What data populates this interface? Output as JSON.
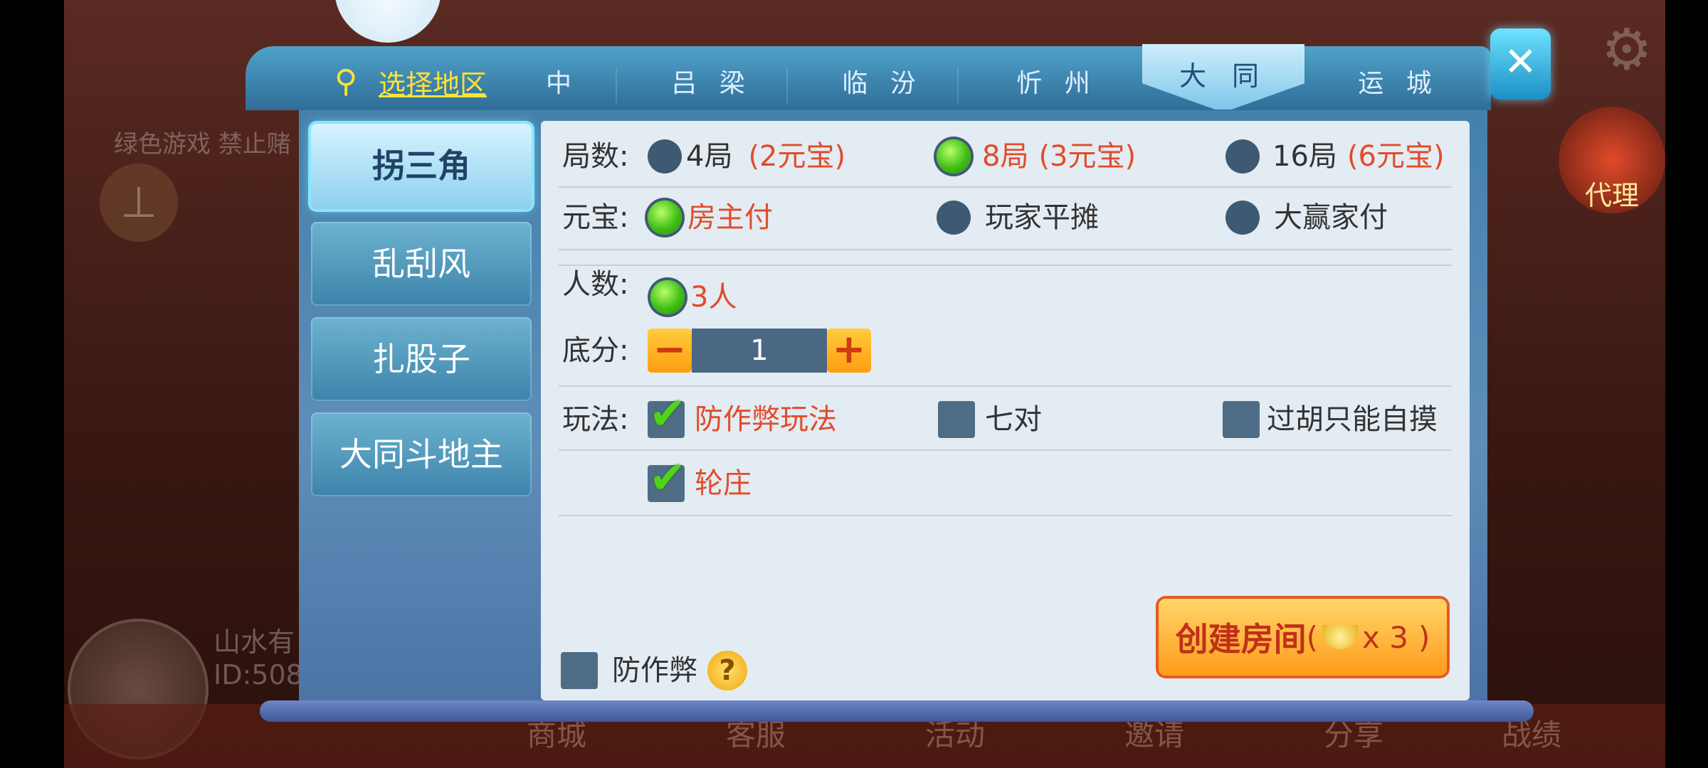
{
  "region": {
    "select_label": "选择地区",
    "tabs": [
      "中",
      "吕 梁",
      "临 汾",
      "忻 州",
      "大 同",
      "运 城"
    ],
    "active_tab": "大 同"
  },
  "games": [
    "拐三角",
    "乱刮风",
    "扎股子",
    "大同斗地主"
  ],
  "active_game": "拐三角",
  "settings": {
    "rounds": {
      "label": "局数:",
      "options": [
        {
          "name": "4局",
          "cost": "(2元宝)",
          "selected": false
        },
        {
          "name": "8局",
          "cost": "(3元宝)",
          "selected": true
        },
        {
          "name": "16局",
          "cost": "(6元宝)",
          "selected": false
        }
      ]
    },
    "payment": {
      "label": "元宝:",
      "options": [
        {
          "name": "房主付",
          "selected": true
        },
        {
          "name": "玩家平摊",
          "selected": false
        },
        {
          "name": "大赢家付",
          "selected": false
        }
      ]
    },
    "players": {
      "label": "人数:",
      "options": [
        {
          "name": "3人",
          "selected": true
        }
      ]
    },
    "base_score": {
      "label": "底分:",
      "value": "1",
      "minus": "−",
      "plus": "+"
    },
    "play_rules": {
      "label": "玩法:",
      "options": [
        {
          "name": "防作弊玩法",
          "checked": true
        },
        {
          "name": "七对",
          "checked": false
        },
        {
          "name": "过胡只能自摸",
          "checked": false
        },
        {
          "name": "轮庄",
          "checked": true
        }
      ]
    },
    "anti_cheat": {
      "label": "防作弊",
      "checked": false,
      "help": "?"
    }
  },
  "create_button": {
    "label": "创建房间",
    "cost": "x 3",
    "open_paren": "(",
    "close_paren": ")"
  },
  "close_label": "✕",
  "background": {
    "notice": "绿色游戏 禁止赌",
    "user_name": "山水有",
    "user_id": "ID:508",
    "agent_label": "代理",
    "bottom_nav": [
      "商城",
      "客服",
      "活动",
      "邀请",
      "分享",
      "战绩"
    ]
  },
  "colors": {
    "accent_red": "#e24b2a",
    "selected_green": "#3fbf15",
    "region_yellow": "#ffe234"
  }
}
